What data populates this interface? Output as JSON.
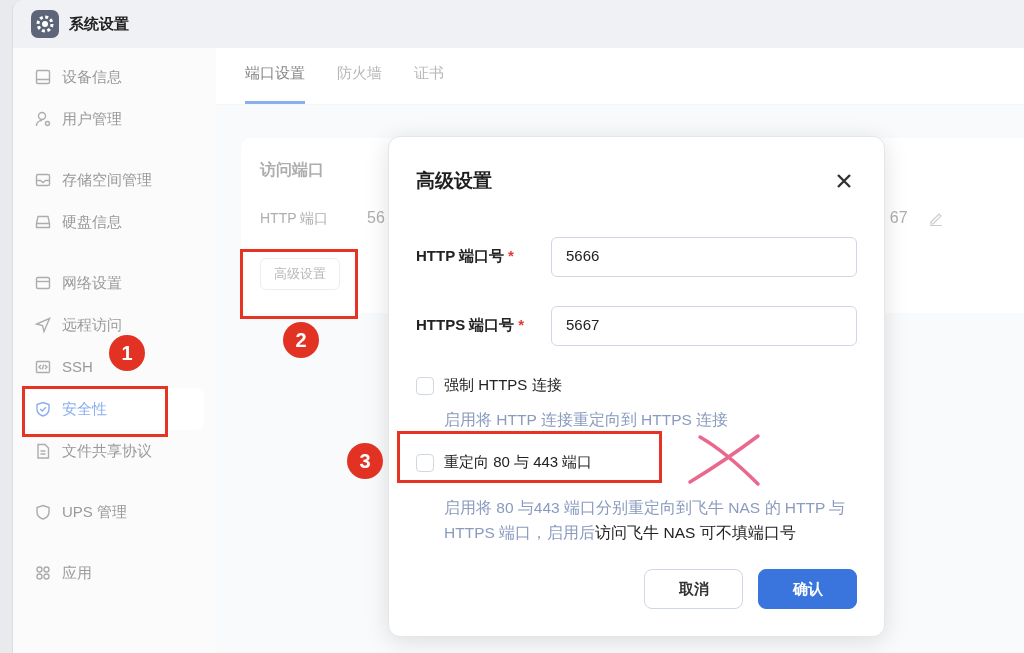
{
  "window": {
    "title": "系统设置"
  },
  "sidebar": {
    "groups": [
      {
        "items": [
          {
            "label": "设备信息",
            "selected": false
          },
          {
            "label": "用户管理",
            "selected": false
          }
        ]
      },
      {
        "items": [
          {
            "label": "存储空间管理",
            "selected": false
          },
          {
            "label": "硬盘信息",
            "selected": false
          }
        ]
      },
      {
        "items": [
          {
            "label": "网络设置",
            "selected": false
          },
          {
            "label": "远程访问",
            "selected": false
          },
          {
            "label": "SSH",
            "selected": false
          },
          {
            "label": "安全性",
            "selected": true
          },
          {
            "label": "文件共享协议",
            "selected": false
          }
        ]
      },
      {
        "items": [
          {
            "label": "UPS 管理",
            "selected": false
          }
        ]
      },
      {
        "items": [
          {
            "label": "应用",
            "selected": false
          }
        ]
      }
    ]
  },
  "tabs": [
    {
      "label": "端口设置",
      "selected": true
    },
    {
      "label": "防火墙",
      "selected": false
    },
    {
      "label": "证书",
      "selected": false
    }
  ],
  "card": {
    "title": "访问端口",
    "row": {
      "label": "HTTP 端口",
      "value": "56",
      "trailing_value": "67"
    },
    "button": "高级设置"
  },
  "dialog": {
    "title": "高级设置",
    "fields": [
      {
        "label": "HTTP 端口号",
        "required_mark": "*",
        "value": "5666"
      },
      {
        "label": "HTTPS 端口号",
        "required_mark": "*",
        "value": "5667"
      }
    ],
    "options": [
      {
        "label": "强制 HTTPS 连接",
        "checked": false,
        "description": [
          {
            "text": "启用将 HTTP 连接重定向到 HTTPS 连接",
            "emphasis": false
          }
        ]
      },
      {
        "label": "重定向 80 与 443 端口",
        "checked": false,
        "description": [
          {
            "text": "启用将 80 与443 端口分别重定向到飞牛 NAS 的 HTTP 与 HTTPS 端口，启用后",
            "emphasis": false
          },
          {
            "text": "访问飞牛 NAS 可不填端口号",
            "emphasis": true
          }
        ]
      }
    ],
    "buttons": [
      {
        "label": "取消",
        "kind": "secondary"
      },
      {
        "label": "确认",
        "kind": "primary"
      }
    ]
  },
  "annotations": {
    "markers": [
      "1",
      "2",
      "3"
    ]
  }
}
